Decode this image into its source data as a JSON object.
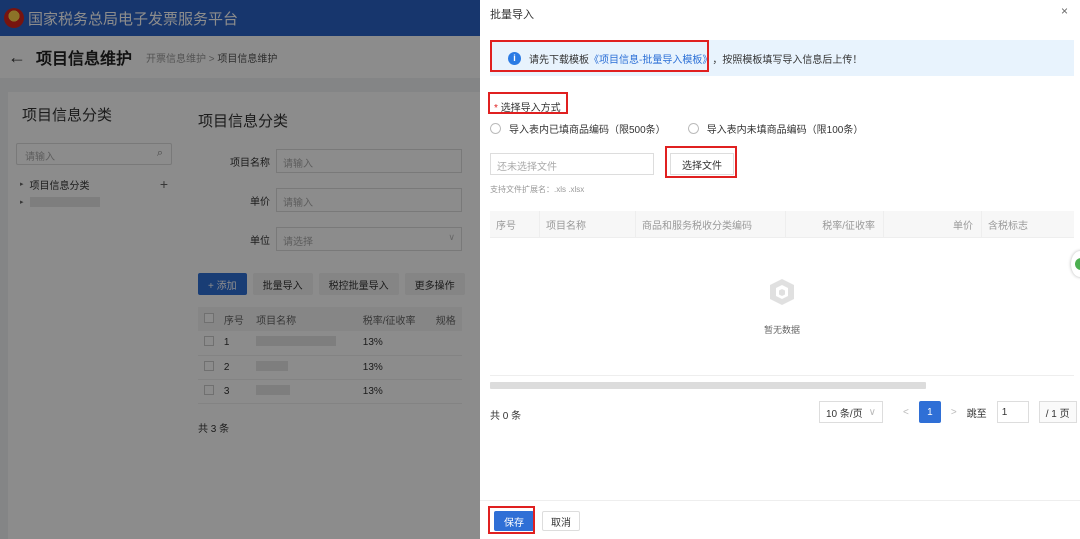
{
  "platform": {
    "title": "国家税务总局电子发票服务平台"
  },
  "page": {
    "title": "项目信息维护",
    "breadcrumb": [
      "开票信息维护",
      "项目信息维护"
    ]
  },
  "sidebar": {
    "title": "项目信息分类",
    "search_placeholder": "请输入",
    "tree": [
      {
        "label": "项目信息分类"
      }
    ]
  },
  "main": {
    "title": "项目信息分类",
    "fields": [
      {
        "label": "项目名称",
        "placeholder": "请输入"
      },
      {
        "label": "单价",
        "placeholder": "请输入"
      },
      {
        "label": "单位",
        "placeholder": "请选择"
      }
    ],
    "buttons": {
      "add": "+ 添加",
      "batch_import": "批量导入",
      "tax_batch_import": "税控批量导入",
      "more": "更多操作"
    },
    "table": {
      "columns": [
        "序号",
        "项目名称",
        "税率/征收率",
        "规格"
      ],
      "rows": [
        {
          "no": "1",
          "rate": "13%"
        },
        {
          "no": "2",
          "rate": "13%"
        },
        {
          "no": "3",
          "rate": "13%"
        }
      ]
    },
    "total": "共 3 条"
  },
  "drawer": {
    "title": "批量导入",
    "close": "×",
    "alert": {
      "prefix": "请先下载模板",
      "link": "《项目信息-批量导入模板》",
      "suffix": "，按照模板填写导入信息后上传！"
    },
    "import_method": {
      "required_mark": "*",
      "label": "选择导入方式"
    },
    "radio_options": [
      "导入表内已填商品编码（限500条）",
      "导入表内未填商品编码（限100条）"
    ],
    "file_input_placeholder": "还未选择文件",
    "file_button": "选择文件",
    "file_hint": "支持文件扩展名：.xls .xlsx",
    "table_columns": [
      "序号",
      "项目名称",
      "商品和服务税收分类编码",
      "税率/征收率",
      "单价",
      "含税标志"
    ],
    "empty_text": "暂无数据",
    "total": "共 0 条",
    "pagination": {
      "page_size": "10 条/页",
      "current_page": "1",
      "jump_label": "跳至",
      "jump_value": "1",
      "total_pages": "/ 1 页"
    },
    "save": "保存",
    "cancel": "取消"
  },
  "colors": {
    "primary": "#2f6fd6",
    "header": "#2b63c6",
    "highlight": "#e02020",
    "alert_bg": "#e8f3fd"
  }
}
